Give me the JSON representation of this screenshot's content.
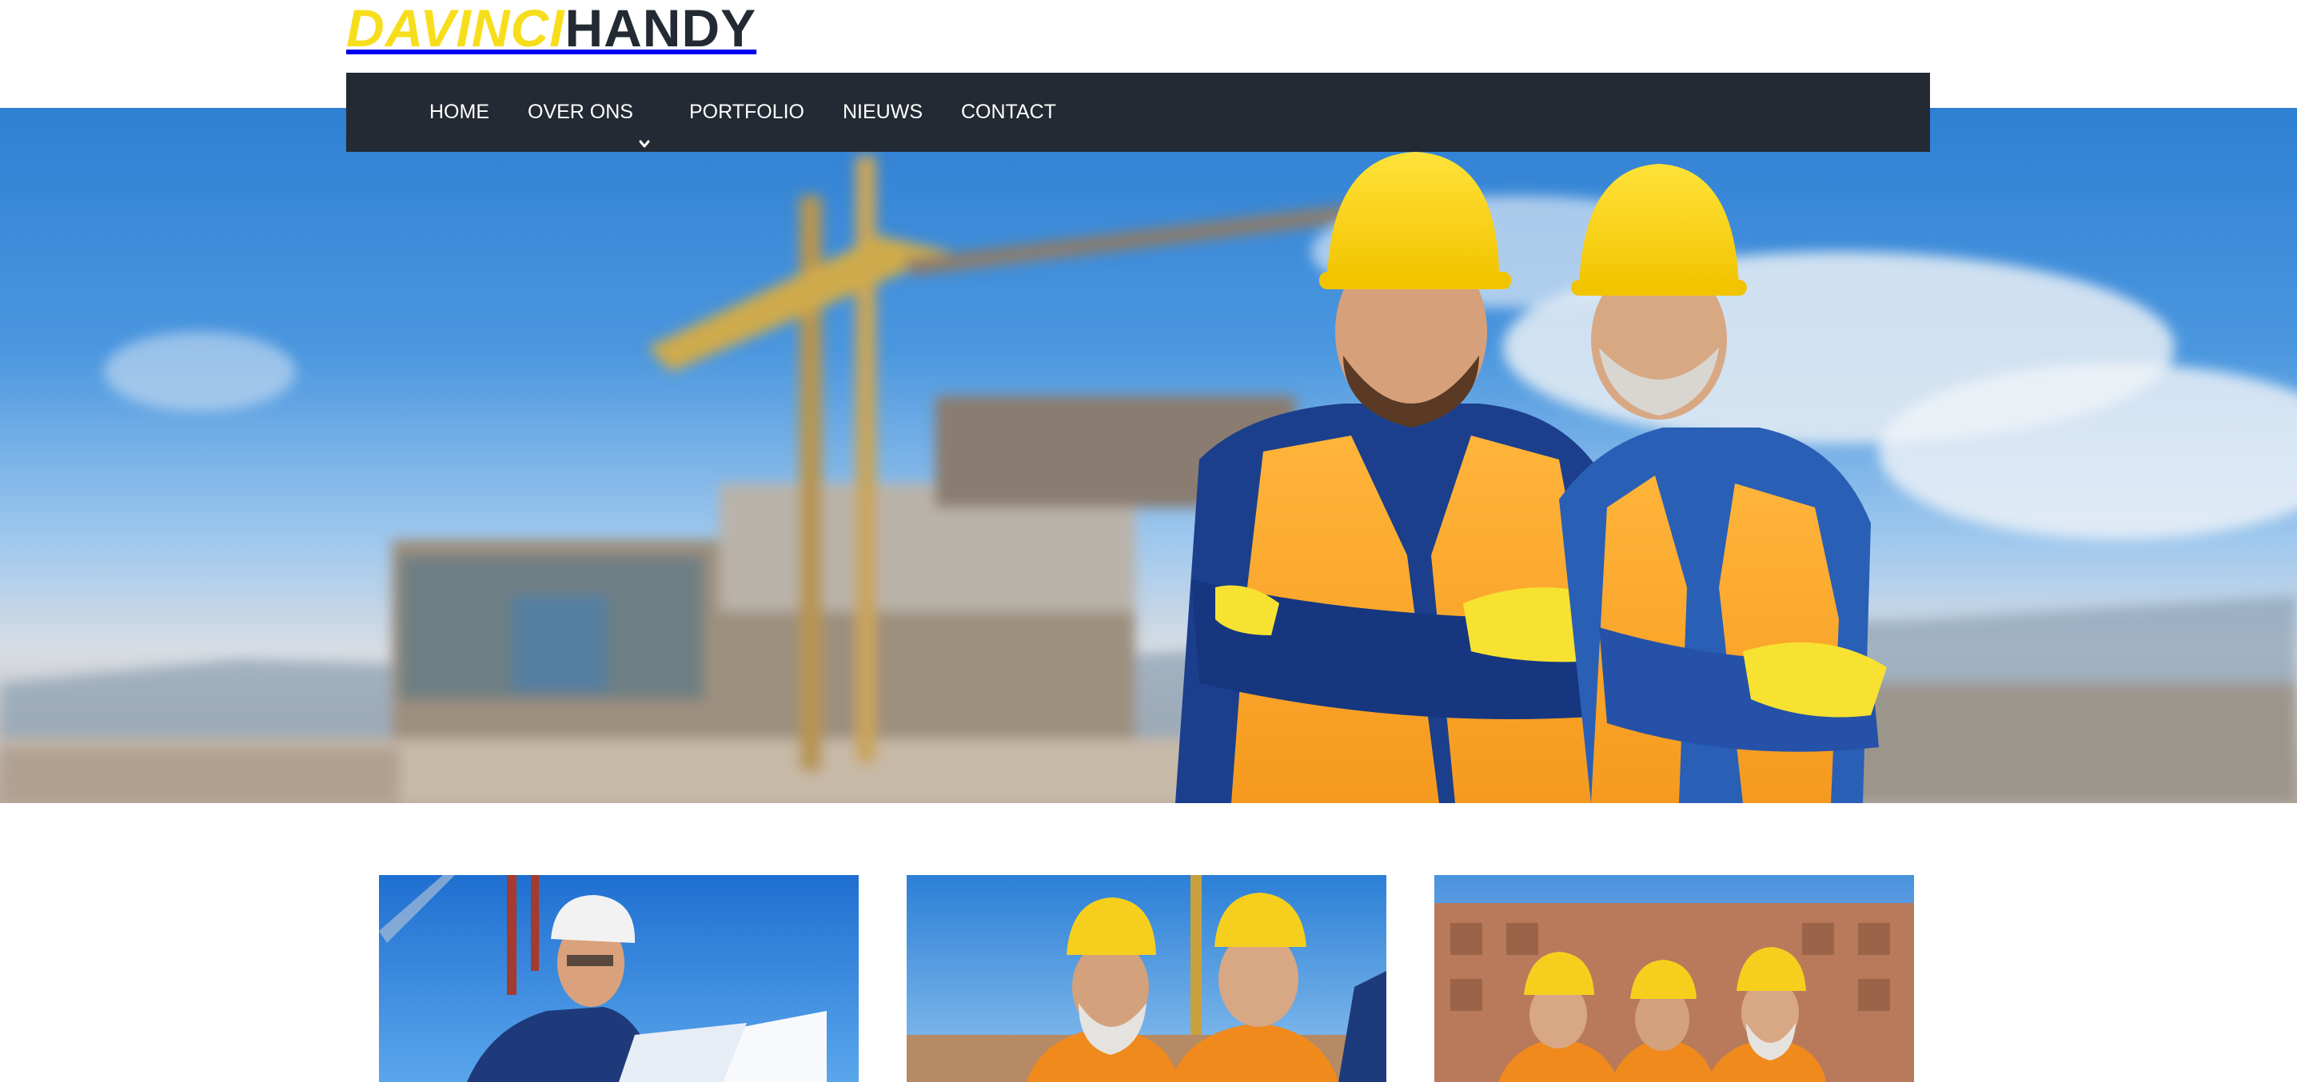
{
  "brand": {
    "logo_part_a": "DAVINCI",
    "logo_part_b": "HANDY",
    "accent_color": "#f7de1c",
    "dark_color": "#242a33"
  },
  "nav": {
    "items": [
      {
        "label": "HOME"
      },
      {
        "label": "OVER ONS",
        "icon": "chevron-down-icon"
      },
      {
        "label": "PORTFOLIO"
      },
      {
        "label": "NIEUWS"
      },
      {
        "label": "CONTACT"
      }
    ]
  },
  "hero": {
    "image": "two-construction-workers-hardhats-crossed-arms-photo"
  },
  "cards": [
    {
      "image": "engineer-with-hardhat-reading-blueprint-photo"
    },
    {
      "image": "two-workers-yellow-hardhats-photo"
    },
    {
      "image": "three-workers-in-front-of-building-photo"
    }
  ]
}
